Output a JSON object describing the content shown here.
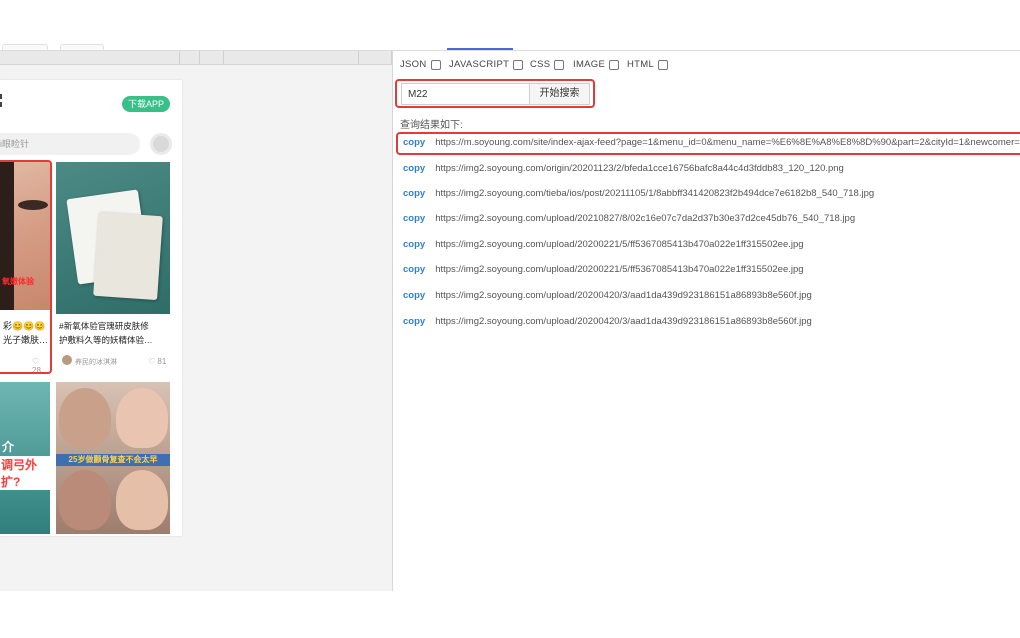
{
  "devtools": {
    "type_filters": [
      {
        "label": "JSON",
        "checked": false
      },
      {
        "label": "JAVASCRIPT",
        "checked": false
      },
      {
        "label": "CSS",
        "checked": false
      },
      {
        "label": "IMAGE",
        "checked": false
      },
      {
        "label": "HTML",
        "checked": false
      }
    ],
    "search_value": "M22",
    "search_button": "开始搜索",
    "results_label": "查询结果如下:",
    "copy_label": "copy",
    "results": [
      "https://m.soyoung.com/site/index-ajax-feed?page=1&menu_id=0&menu_name=%E6%8E%A8%E8%8D%90&part=2&cityId=1&newcomer=",
      "https://img2.soyoung.com/origin/20201123/2/bfeda1cce16756bafc8a44c4d3fddb83_120_120.png",
      "https://img2.soyoung.com/tieba/ios/post/20211105/1/8abbff341420823f2b494dce7e6182b8_540_718.jpg",
      "https://img2.soyoung.com/upload/20210827/8/02c16e07c7da2d37b30e37d2ce45db76_540_718.jpg",
      "https://img2.soyoung.com/upload/20200221/5/ff5367085413b470a022e1ff315502ee.jpg",
      "https://img2.soyoung.com/upload/20200221/5/ff5367085413b470a022e1ff315502ee.jpg",
      "https://img2.soyoung.com/upload/20200420/3/aad1da439d923186151a86893b8e560f.jpg",
      "https://img2.soyoung.com/upload/20200420/3/aad1da439d923186151a86893b8e560f.jpg"
    ]
  },
  "phone": {
    "download_button": "下载APP",
    "search_placeholder": "i眼睑针",
    "feed": [
      {
        "title_line1": "彩😊😊😊",
        "title_line2": "光子嫩肤…",
        "likes": "28",
        "overlay": "氧嫩体验"
      },
      {
        "title_line1": "#新氧体验官瑰研皮肤修",
        "title_line2": "护敷料久等的妖精体验…",
        "author": "养民的冰淇淋",
        "likes": "81"
      },
      {
        "overlay_line1": "介",
        "overlay_line2": "调弓外扩?"
      },
      {
        "banner": "25岁做颧骨复查不会太早"
      }
    ]
  },
  "colors": {
    "accent_blue": "#2f7fd6",
    "download_green": "#3bbf8a",
    "highlight_red": "#e33a3a"
  }
}
